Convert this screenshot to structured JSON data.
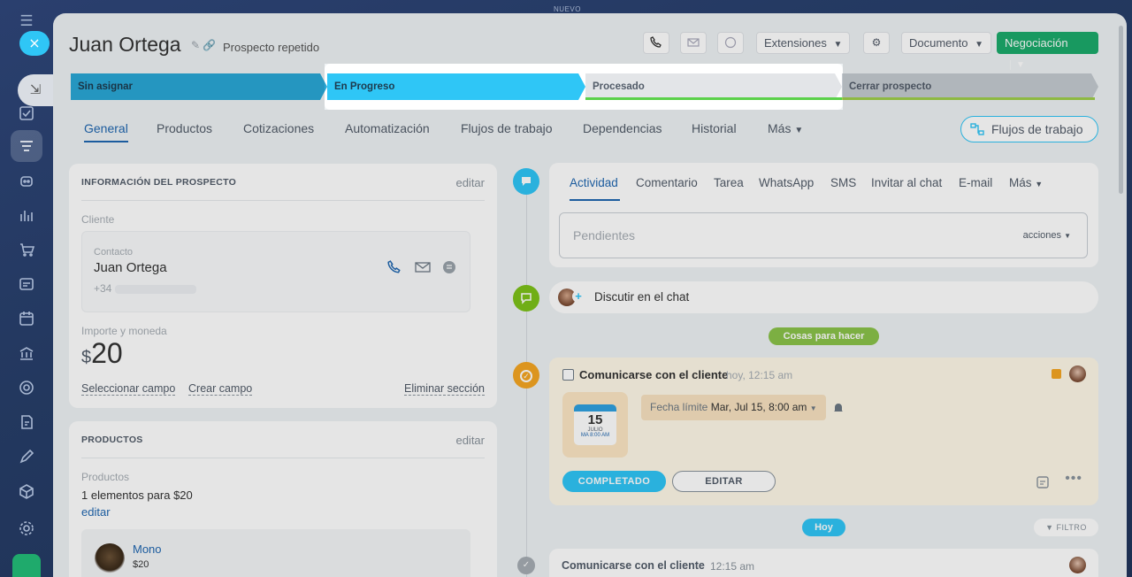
{
  "topbar": {
    "label": "NUEVO"
  },
  "rail": {
    "close_icon": "×",
    "minimize_icon": "⇲"
  },
  "header": {
    "title": "Juan Ortega",
    "subtitle": "Prospecto repetido",
    "extensions_label": "Extensiones",
    "document_label": "Documento",
    "deal_label": "Negociación"
  },
  "stages": [
    {
      "label": "Sin asignar",
      "color": "#2aa8d6"
    },
    {
      "label": "En Progreso",
      "color": "#2fc6f6"
    },
    {
      "label": "Procesado",
      "color": "#e3e5e8"
    },
    {
      "label": "Cerrar prospecto",
      "color": "#c5cbd1"
    }
  ],
  "tabs": [
    "General",
    "Productos",
    "Cotizaciones",
    "Automatización",
    "Flujos de trabajo",
    "Dependencias",
    "Historial",
    "Más"
  ],
  "flow_button": "Flujos de trabajo",
  "lead_info": {
    "header": "INFORMACIÓN DEL PROSPECTO",
    "edit": "editar",
    "client_label": "Cliente",
    "contact_label": "Contacto",
    "contact_name": "Juan Ortega",
    "phone_prefix": "+34",
    "amount_label": "Importe y moneda",
    "currency": "$",
    "amount": "20",
    "select_field": "Seleccionar campo",
    "create_field": "Crear campo",
    "delete_section": "Eliminar sección"
  },
  "products": {
    "header": "PRODUCTOS",
    "edit": "editar",
    "label": "Productos",
    "summary": "1 elementos para $20",
    "edit_link": "editar",
    "item_name": "Mono",
    "item_price": "$20"
  },
  "activity": {
    "tabs": [
      "Actividad",
      "Comentario",
      "Tarea",
      "WhatsApp",
      "SMS",
      "Invitar al chat",
      "E-mail",
      "Más"
    ],
    "pending_placeholder": "Pendientes",
    "actions": "acciones",
    "discuss": "Discutir en el chat",
    "todo_badge": "Cosas para hacer",
    "task_title": "Comunicarse con el cliente",
    "task_time": "hoy, 12:15 am",
    "calendar_day": "15",
    "calendar_month": "JULIO",
    "calendar_time": "MA 8:00 AM",
    "deadline_label": "Fecha límite",
    "deadline_value": "Mar, Jul 15, 8:00 am",
    "completed_btn": "COMPLETADO",
    "edit_btn": "EDITAR",
    "today_badge": "Hoy",
    "filter": "FILTRO",
    "history_title": "Comunicarse con el cliente",
    "history_time": "12:15 am"
  }
}
